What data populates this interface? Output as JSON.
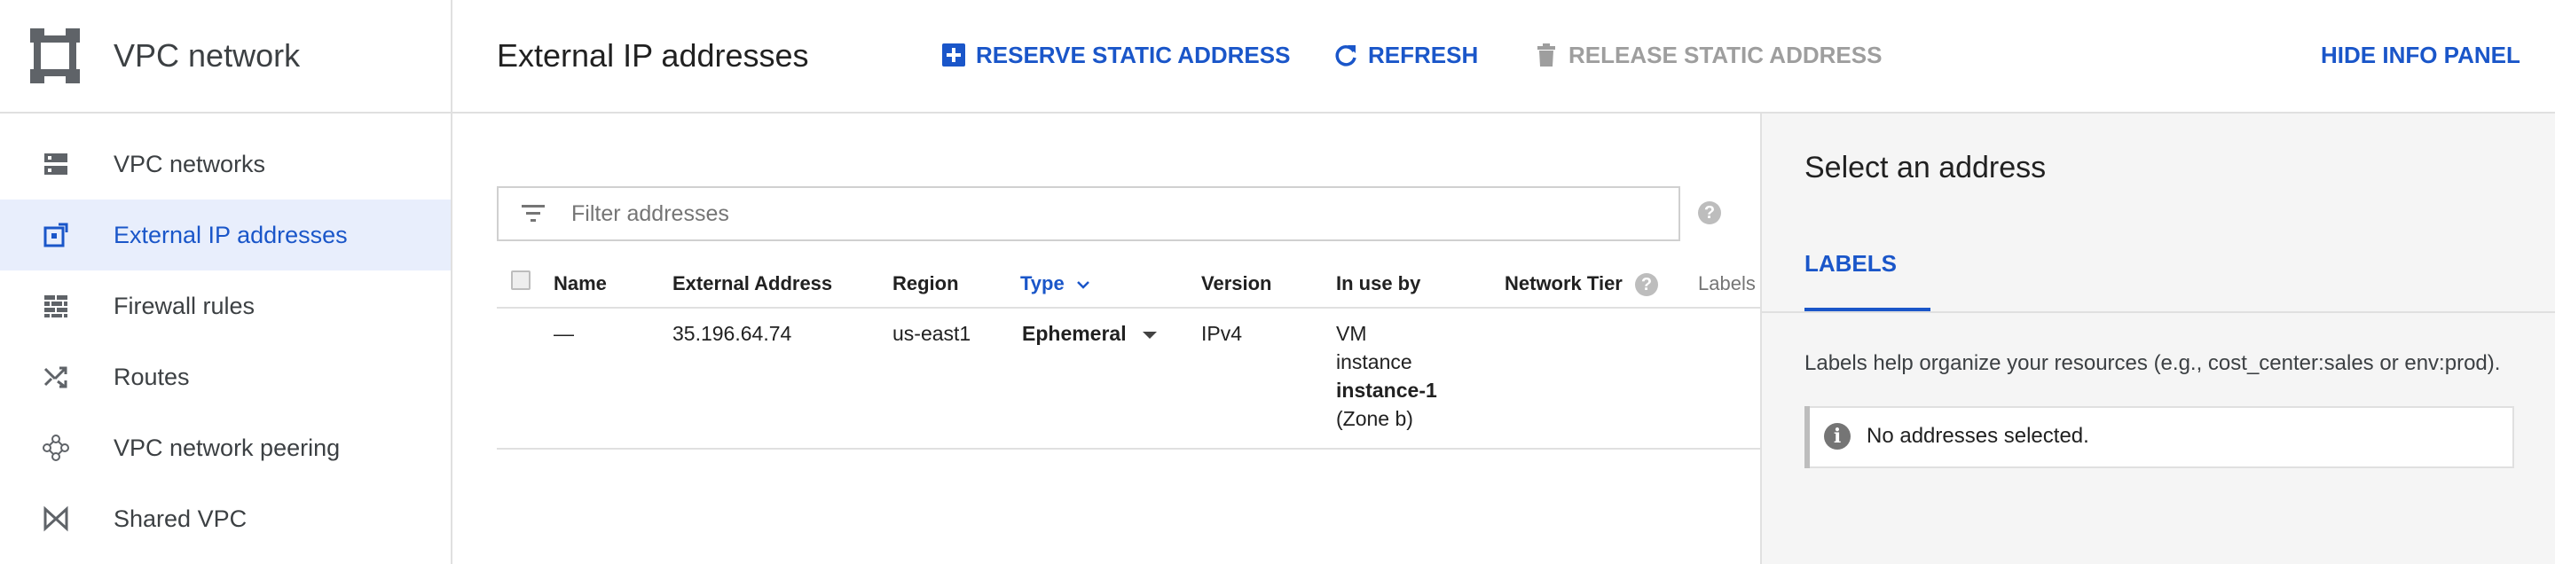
{
  "product": {
    "title": "VPC network",
    "icon": "vpc-network-icon"
  },
  "sidebar": {
    "items": [
      {
        "label": "VPC networks",
        "icon": "vpc-networks-icon",
        "active": false
      },
      {
        "label": "External IP addresses",
        "icon": "external-ip-icon",
        "active": true
      },
      {
        "label": "Firewall rules",
        "icon": "firewall-icon",
        "active": false
      },
      {
        "label": "Routes",
        "icon": "routes-icon",
        "active": false
      },
      {
        "label": "VPC network peering",
        "icon": "peering-icon",
        "active": false
      },
      {
        "label": "Shared VPC",
        "icon": "shared-vpc-icon",
        "active": false
      }
    ]
  },
  "header": {
    "title": "External IP addresses",
    "reserve_label": "RESERVE STATIC ADDRESS",
    "refresh_label": "REFRESH",
    "release_label": "RELEASE STATIC ADDRESS",
    "hide_panel_label": "HIDE INFO PANEL"
  },
  "filter": {
    "placeholder": "Filter addresses"
  },
  "table": {
    "columns": {
      "name": "Name",
      "external_address": "External Address",
      "region": "Region",
      "type": "Type",
      "version": "Version",
      "in_use_by": "In use by",
      "network_tier": "Network Tier",
      "labels": "Labels"
    },
    "rows": [
      {
        "name": "—",
        "external_address": "35.196.64.74",
        "region": "us-east1",
        "type": "Ephemeral",
        "version": "IPv4",
        "in_use_by": [
          "VM",
          "instance",
          "instance-1",
          "(Zone b)"
        ]
      }
    ]
  },
  "info_panel": {
    "title": "Select an address",
    "tab_label": "LABELS",
    "description": "Labels help organize your resources (e.g., cost_center:sales or env:prod).",
    "notice": "No addresses selected."
  },
  "colors": {
    "accent": "#1a56c9",
    "active_bg": "#e8eefc",
    "panel_bg": "#f5f5f5"
  }
}
